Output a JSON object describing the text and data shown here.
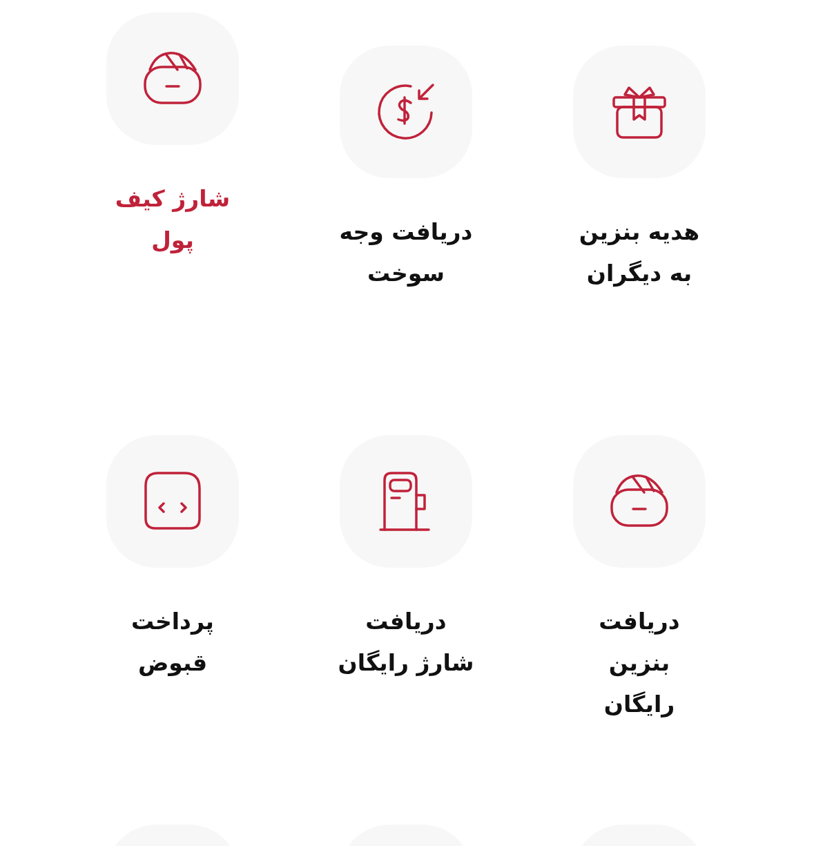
{
  "services": [
    {
      "label": "هدیه بنزین به دیگران",
      "selected": false
    },
    {
      "label": "دریافت وجه سوخت",
      "selected": false
    },
    {
      "label": "شارژ کیف پول",
      "selected": true
    },
    {
      "label": "دریافت بنزین رایگان",
      "selected": false
    },
    {
      "label": "دریافت شارژ رایگان",
      "selected": false
    },
    {
      "label": "پرداخت قبوض",
      "selected": false
    }
  ],
  "cut_tiles": [
    {
      "kind": "tile"
    },
    {
      "kind": "tile"
    },
    {
      "kind": "tile"
    }
  ]
}
